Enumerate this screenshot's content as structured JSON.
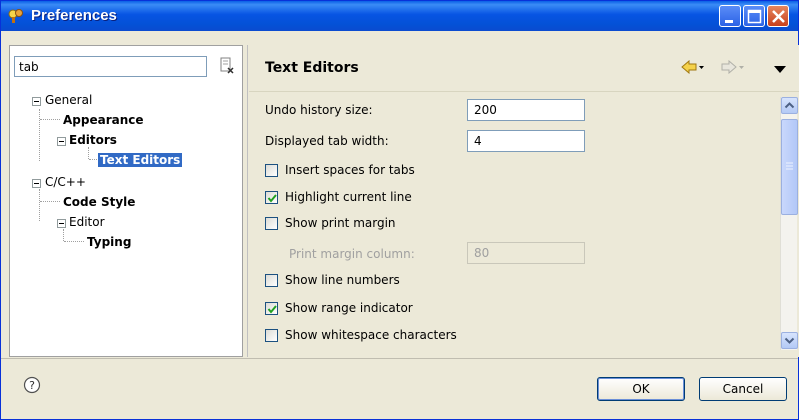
{
  "window": {
    "title": "Preferences"
  },
  "filter": {
    "value": "tab"
  },
  "tree": {
    "general": "General",
    "appearance": "Appearance",
    "editors": "Editors",
    "text_editors": "Text Editors",
    "cpp": "C/C++",
    "code_style": "Code Style",
    "editor": "Editor",
    "typing": "Typing"
  },
  "page": {
    "title": "Text Editors"
  },
  "settings": {
    "undo_label": "Undo history size:",
    "undo_value": "200",
    "tab_width_label": "Displayed tab width:",
    "tab_width_value": "4",
    "insert_spaces_label": "Insert spaces for tabs",
    "insert_spaces_checked": false,
    "highlight_line_label": "Highlight current line",
    "highlight_line_checked": true,
    "show_print_margin_label": "Show print margin",
    "show_print_margin_checked": false,
    "print_margin_col_label": "Print margin column:",
    "print_margin_col_value": "80",
    "show_line_numbers_label": "Show line numbers",
    "show_line_numbers_checked": false,
    "show_range_label": "Show range indicator",
    "show_range_checked": true,
    "show_whitespace_label": "Show whitespace characters",
    "show_whitespace_checked": false
  },
  "buttons": {
    "ok": "OK",
    "cancel": "Cancel"
  },
  "colors": {
    "titlebar": "#0754e3",
    "selection": "#316ac5",
    "dialog_bg": "#ece9d8"
  }
}
